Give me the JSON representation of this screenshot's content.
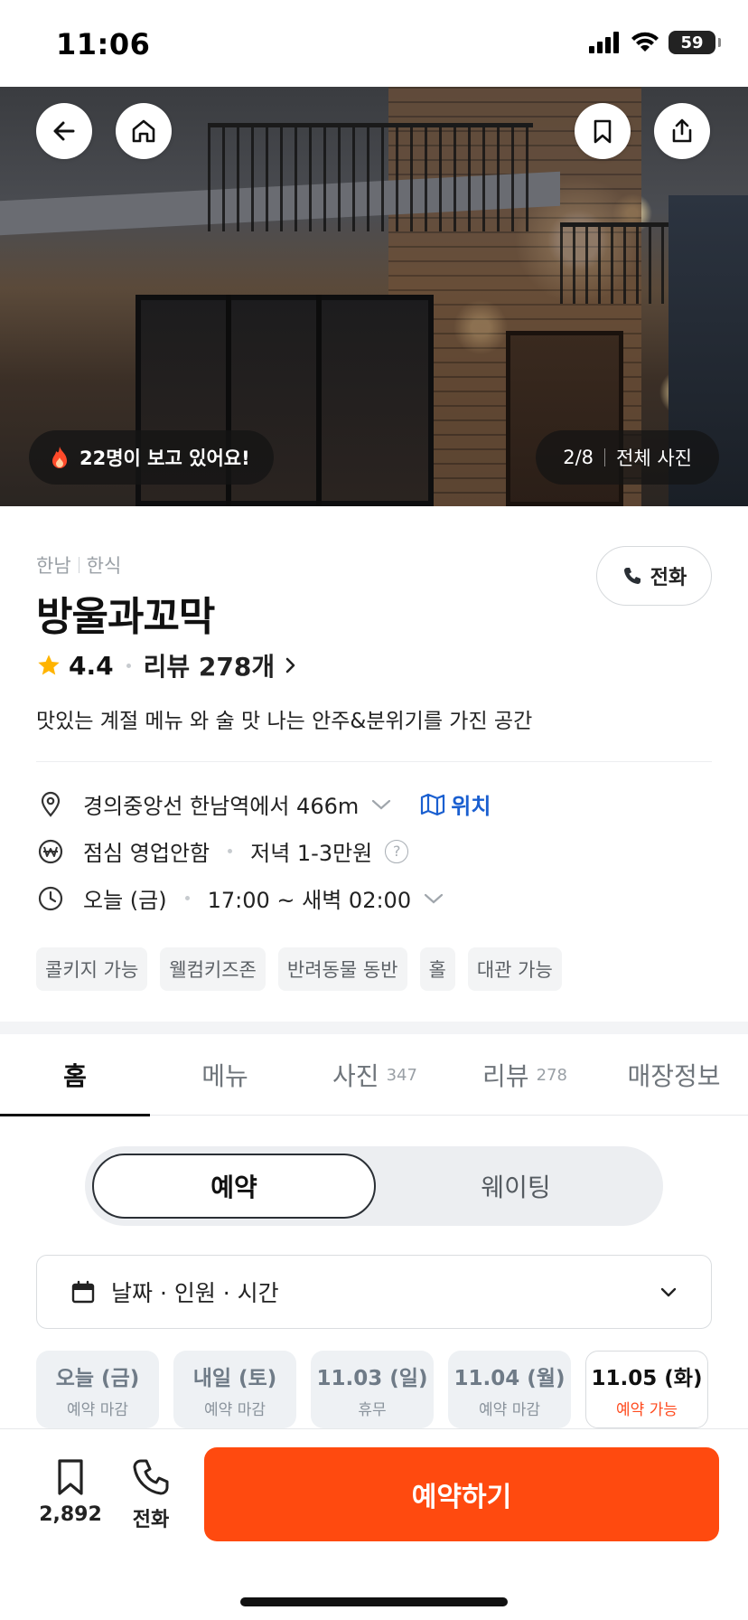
{
  "status_bar": {
    "time": "11:06",
    "battery": "59"
  },
  "hero": {
    "viewers": "22명이 보고 있어요!",
    "photo_index": "2/8",
    "all_photos": "전체 사진"
  },
  "shop": {
    "area": "한남",
    "category": "한식",
    "name": "방울과꼬막",
    "call_label": "전화",
    "rating": "4.4",
    "review_link": "리뷰 278개",
    "description": "맛있는 계절 메뉴 와 술 맛 나는 안주&분위기를 가진 공간"
  },
  "meta": {
    "location": "경의중앙선 한남역에서 466m",
    "map_label": "위치",
    "lunch": "점심 영업안함",
    "dinner": "저녁 1-3만원",
    "help": "?",
    "hours_day": "오늘 (금)",
    "hours": "17:00 ~ 새벽 02:00"
  },
  "tags": [
    "콜키지 가능",
    "웰컴키즈존",
    "반려동물 동반",
    "홀",
    "대관 가능"
  ],
  "tabs": [
    {
      "label": "홈",
      "count": ""
    },
    {
      "label": "메뉴",
      "count": ""
    },
    {
      "label": "사진",
      "count": "347"
    },
    {
      "label": "리뷰",
      "count": "278"
    },
    {
      "label": "매장정보",
      "count": ""
    }
  ],
  "segment": {
    "reserve": "예약",
    "waiting": "웨이팅"
  },
  "selector": {
    "label": "날짜 · 인원 · 시간"
  },
  "dates": [
    {
      "day": "오늘 (금)",
      "status": "예약 마감"
    },
    {
      "day": "내일 (토)",
      "status": "예약 마감"
    },
    {
      "day": "11.03 (일)",
      "status": "휴무"
    },
    {
      "day": "11.04 (월)",
      "status": "예약 마감"
    },
    {
      "day": "11.05 (화)",
      "status": "예약 가능"
    }
  ],
  "bottom": {
    "bookmark_count": "2,892",
    "call_label": "전화",
    "reserve_label": "예약하기"
  },
  "colors": {
    "accent": "#ff4a0f",
    "link": "#1a5fd0",
    "open_status": "#ff4b1f"
  }
}
